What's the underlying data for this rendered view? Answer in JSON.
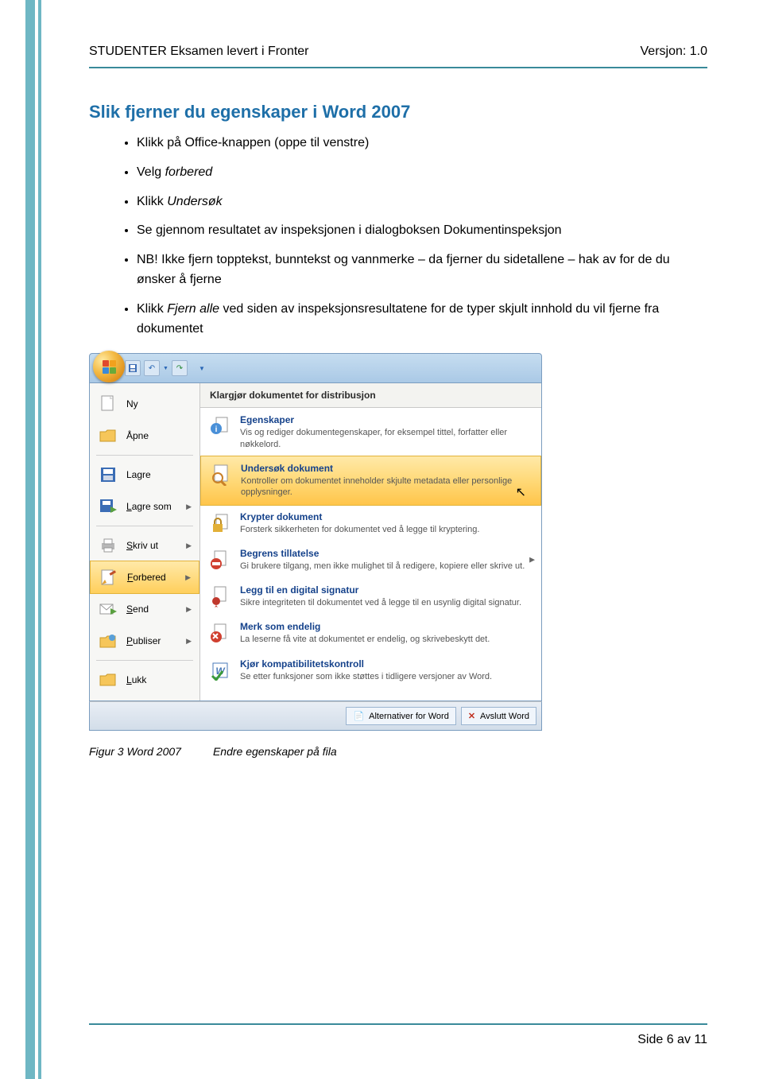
{
  "header": {
    "title": "STUDENTER Eksamen levert i Fronter",
    "version": "Versjon: 1.0"
  },
  "section_title": "Slik fjerner du egenskaper i Word 2007",
  "instructions": {
    "i1": "Klikk på Office-knappen (oppe til venstre)",
    "i2a": "Velg ",
    "i2b": "forbered",
    "i3a": "Klikk ",
    "i3b": "Undersøk",
    "i4": "Se gjennom resultatet av inspeksjonen i dialogboksen Dokumentinspeksjon",
    "i5": "NB! Ikke fjern topptekst, bunntekst og vannmerke – da fjerner du sidetallene – hak av for de du ønsker å fjerne",
    "i6a": "Klikk ",
    "i6b": "Fjern alle",
    "i6c": " ved siden av inspeksjonsresultatene for de typer skjult innhold du vil fjerne fra dokumentet"
  },
  "office": {
    "left": {
      "ny": "Ny",
      "apne": "Åpne",
      "lagre": "Lagre",
      "lagre_som": "Lagre som",
      "skriv_ut": "Skriv ut",
      "forbered": "Forbered",
      "send": "Send",
      "publiser": "Publiser",
      "lukk": "Lukk"
    },
    "right_title": "Klargjør dokumentet for distribusjon",
    "right": {
      "egenskaper": {
        "title": "Egenskaper",
        "desc": "Vis og rediger dokumentegenskaper, for eksempel tittel, forfatter eller nøkkelord."
      },
      "undersok": {
        "title": "Undersøk dokument",
        "desc": "Kontroller om dokumentet inneholder skjulte metadata eller personlige opplysninger."
      },
      "krypter": {
        "title": "Krypter dokument",
        "desc": "Forsterk sikkerheten for dokumentet ved å legge til kryptering."
      },
      "begrens": {
        "title": "Begrens tillatelse",
        "desc": "Gi brukere tilgang, men ikke mulighet til å redigere, kopiere eller skrive ut."
      },
      "signatur": {
        "title": "Legg til en digital signatur",
        "desc": "Sikre integriteten til dokumentet ved å legge til en usynlig digital signatur."
      },
      "endelig": {
        "title": "Merk som endelig",
        "desc": "La leserne få vite at dokumentet er endelig, og skrivebeskytt det."
      },
      "kompat": {
        "title": "Kjør kompatibilitetskontroll",
        "desc": "Se etter funksjoner som ikke støttes i tidligere versjoner av Word."
      }
    },
    "footer": {
      "alternativer": "Alternativer for Word",
      "avslutt": "Avslutt Word"
    }
  },
  "caption": {
    "left": "Figur 3 Word 2007",
    "right": "Endre egenskaper på fila"
  },
  "footer": {
    "page": "Side 6 av 11"
  }
}
